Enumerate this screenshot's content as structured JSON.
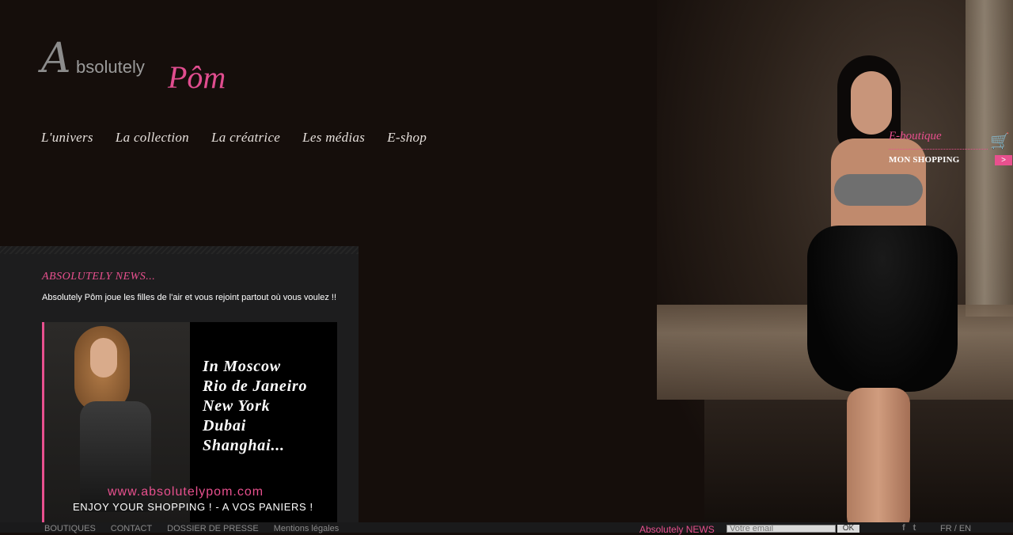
{
  "logo": {
    "initial": "A",
    "word1": "bsolutely",
    "word2": "Pôm"
  },
  "nav": {
    "items": [
      "L'univers",
      "La collection",
      "La créatrice",
      "Les médias",
      "E-shop"
    ]
  },
  "shopping": {
    "eboutique": "E-boutique",
    "mon_shopping": "MON SHOPPING",
    "arrow": ">",
    "cart_icon": "cart-icon"
  },
  "news": {
    "title": "ABSOLUTELY NEWS...",
    "text": "Absolutely Pôm joue les filles de l'air et vous rejoint partout où vous voulez !!",
    "banner": {
      "cities": [
        "In Moscow",
        "Rio de Janeiro",
        "New York",
        "Dubai",
        "Shanghai..."
      ],
      "url": "www.absolutelypom.com",
      "tagline": "ENJOY YOUR SHOPPING !  -  A VOS PANIERS !"
    }
  },
  "footer": {
    "links": [
      "BOUTIQUES",
      "CONTACT",
      "DOSSIER DE PRESSE",
      "Mentions légales"
    ],
    "news_label": "Absolutely NEWS",
    "email_placeholder": "Votre email",
    "ok_label": "OK",
    "social": [
      "f",
      "t"
    ],
    "lang": "FR / EN"
  },
  "colors": {
    "accent": "#e8508e",
    "background": "#150e0b",
    "panel": "#1d1d1e"
  }
}
